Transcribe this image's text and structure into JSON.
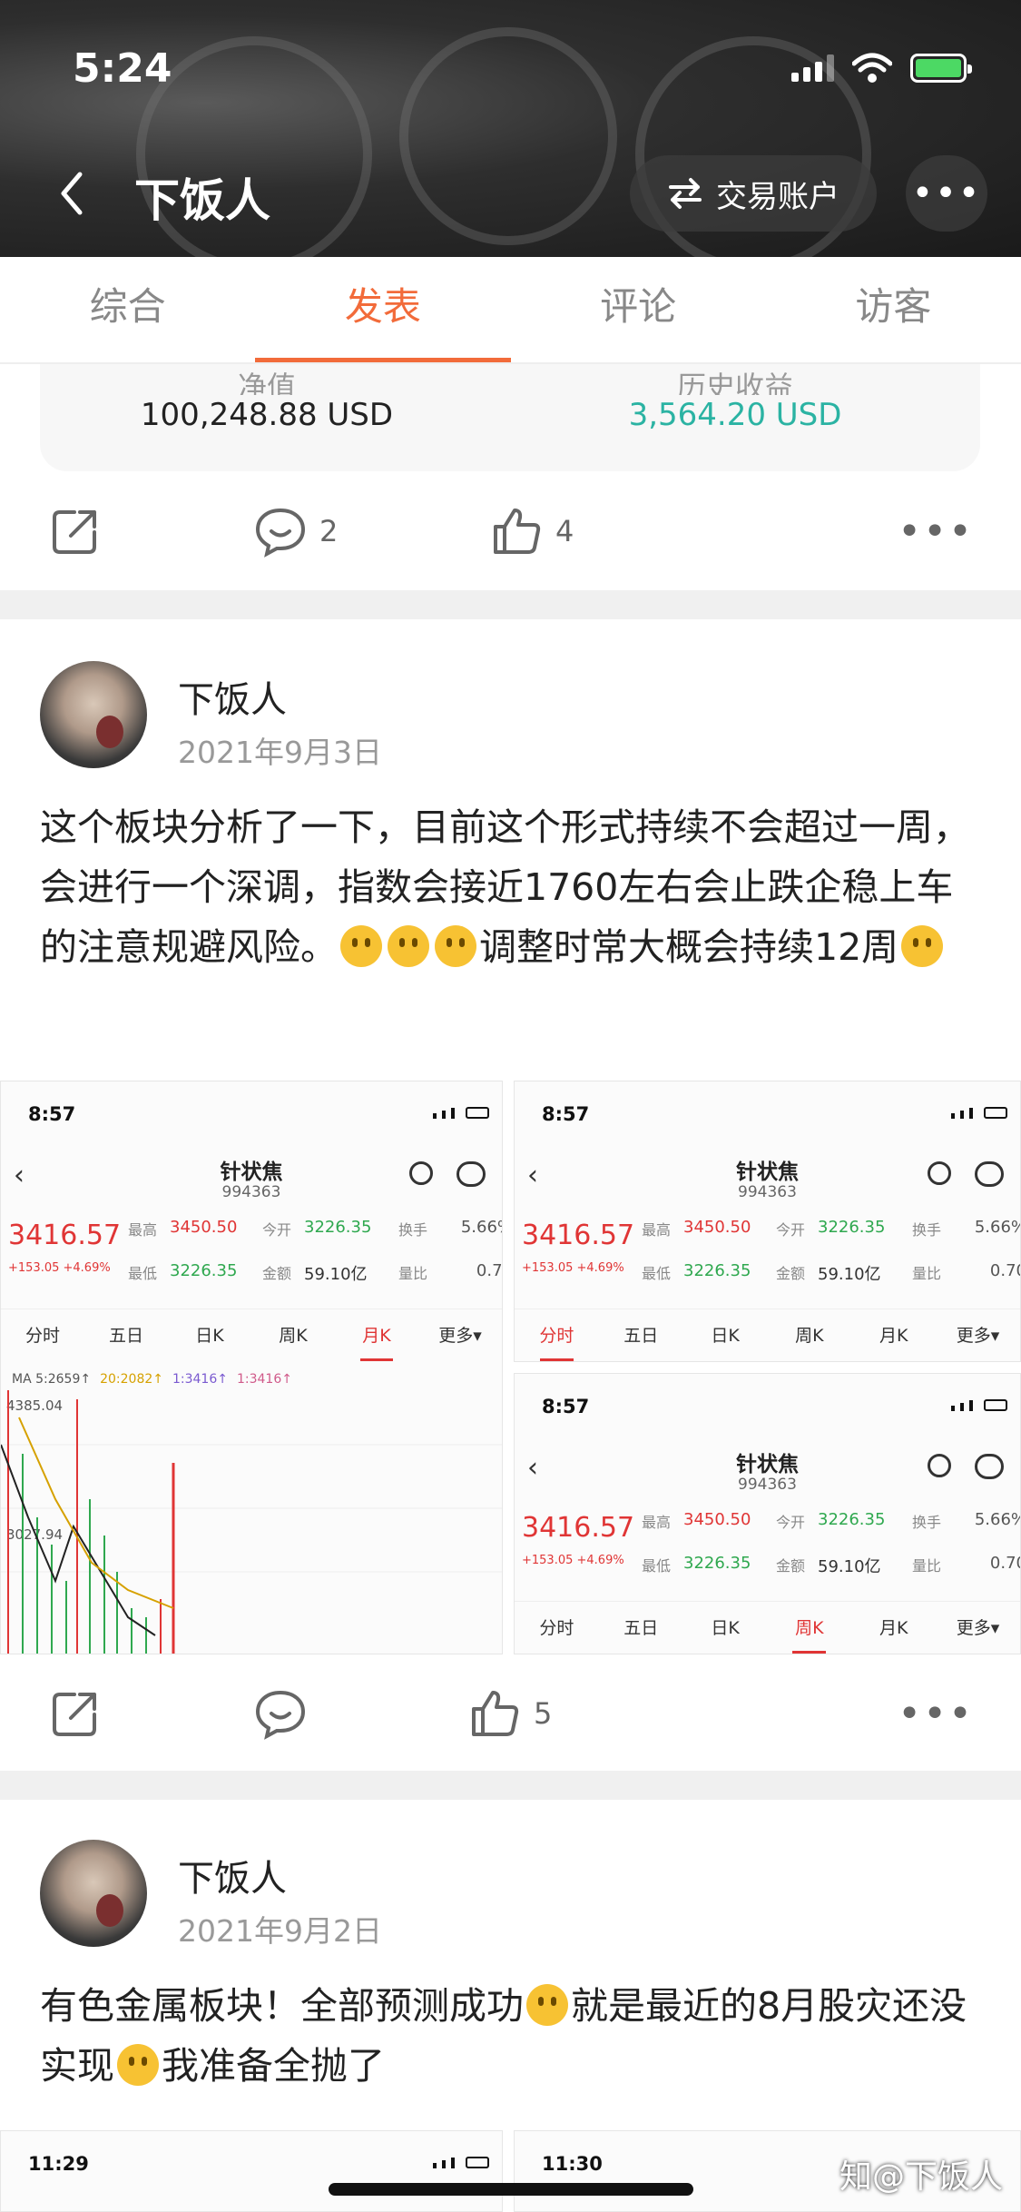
{
  "status_bar": {
    "time": "5:24"
  },
  "nav": {
    "back_icon": "chevron-left-icon",
    "title": "下饭人",
    "trade_button": "交易账户",
    "more": "•••"
  },
  "tabs": [
    {
      "label": "综合",
      "active": false
    },
    {
      "label": "发表",
      "active": true
    },
    {
      "label": "评论",
      "active": false
    },
    {
      "label": "访客",
      "active": false
    }
  ],
  "account_stats": {
    "net_value_label": "净值",
    "net_value": "100,248.88 USD",
    "history_gain_label": "历史收益",
    "history_gain": "3,564.20 USD",
    "gain_color": "#2bb3a3"
  },
  "first_actions": {
    "comments": "2",
    "likes": "4"
  },
  "posts": [
    {
      "author": "下饭人",
      "date": "2021年9月3日",
      "text_parts": [
        "这个板块分析了一下，目前这个形式持续不会超过一周，会进行一个深调，指数会接近1760左右会止跌企稳上车的注意规避风险。",
        "调整时常大概会持续12周"
      ],
      "likes": "5",
      "screenshots": [
        {
          "time": "8:57",
          "title": "针状焦",
          "code": "994363",
          "price": "3416.57",
          "change": "+153.05 +4.69%",
          "high_label": "最高",
          "high": "3450.50",
          "open_label": "今开",
          "open": "3226.35",
          "turnover_label": "换手",
          "turnover": "5.66%",
          "low_label": "最低",
          "low": "3226.35",
          "amount_label": "金额",
          "amount": "59.10亿",
          "ratio_label": "量比",
          "ratio": "0.70",
          "tabs": [
            "分时",
            "五日",
            "日K",
            "周K",
            "月K",
            "更多▾"
          ],
          "active_tab": "月K",
          "ma": [
            "MA 5:2659↑",
            "20:2082↑",
            "1:3416↑",
            "1:3416↑"
          ],
          "chart_high": "4385.04",
          "chart_mid": "3027.94"
        },
        {
          "time": "8:57",
          "title": "针状焦",
          "code": "994363",
          "price": "3416.57",
          "change": "+153.05 +4.69%",
          "tabs": [
            "分时",
            "五日",
            "日K",
            "周K",
            "月K",
            "更多▾"
          ],
          "active_tab": "分时"
        },
        {
          "time": "8:57",
          "title": "针状焦",
          "code": "994363",
          "price": "3416.57",
          "change": "+153.05 +4.69%",
          "tabs": [
            "分时",
            "五日",
            "日K",
            "周K",
            "月K",
            "更多▾"
          ],
          "active_tab": "周K"
        }
      ]
    },
    {
      "author": "下饭人",
      "date": "2021年9月2日",
      "text_parts": [
        "有色金属板块！全部预测成功",
        "就是最近的8月股灾还没实现",
        "我准备全抛了"
      ],
      "screenshot_times": [
        "11:29",
        "11:30"
      ]
    }
  ],
  "watermark": "知@下饭人"
}
